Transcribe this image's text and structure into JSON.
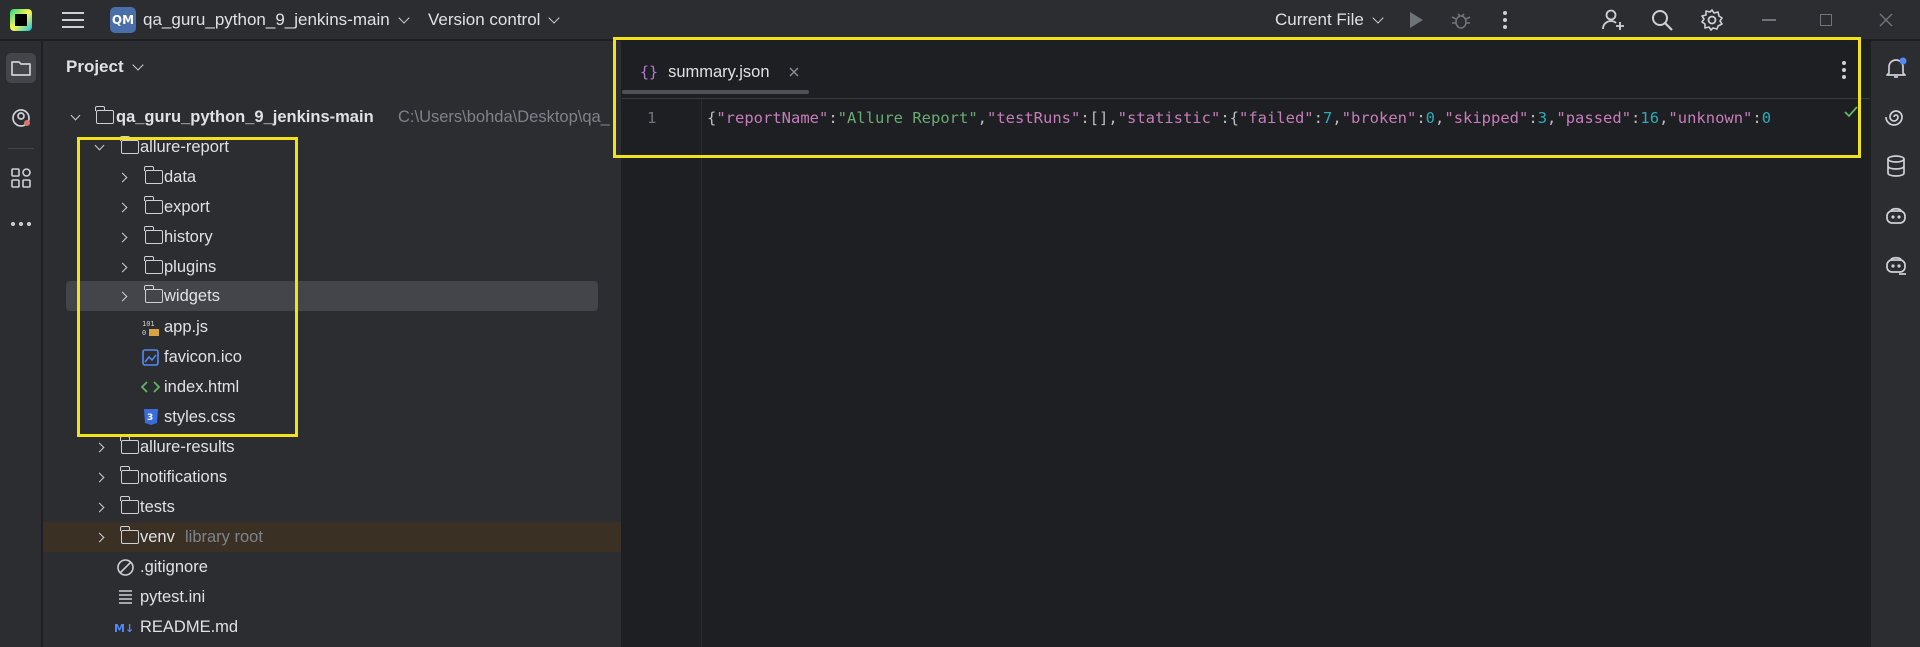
{
  "titlebar": {
    "project_badge": "QM",
    "project_name": "qa_guru_python_9_jenkins-main",
    "version_control": "Version control",
    "run_config": "Current File"
  },
  "project_panel": {
    "title": "Project",
    "root": {
      "name": "qa_guru_python_9_jenkins-main",
      "path": "C:\\Users\\bohda\\Desktop\\qa_"
    },
    "items": [
      {
        "label": "allure-report",
        "kind": "folder",
        "expanded": true
      },
      {
        "label": "data",
        "kind": "folder"
      },
      {
        "label": "export",
        "kind": "folder"
      },
      {
        "label": "history",
        "kind": "folder"
      },
      {
        "label": "plugins",
        "kind": "folder"
      },
      {
        "label": "widgets",
        "kind": "folder"
      },
      {
        "label": "app.js",
        "kind": "js-file"
      },
      {
        "label": "favicon.ico",
        "kind": "image-file"
      },
      {
        "label": "index.html",
        "kind": "html-file"
      },
      {
        "label": "styles.css",
        "kind": "css-file"
      },
      {
        "label": "allure-results",
        "kind": "folder"
      },
      {
        "label": "notifications",
        "kind": "folder"
      },
      {
        "label": "tests",
        "kind": "folder"
      },
      {
        "label": "venv",
        "kind": "folder",
        "note": "library root"
      },
      {
        "label": ".gitignore",
        "kind": "ignore-file"
      },
      {
        "label": "pytest.ini",
        "kind": "ini-file"
      },
      {
        "label": "README.md",
        "kind": "md-file"
      }
    ]
  },
  "editor": {
    "tab_label": "summary.json",
    "line_number": "1",
    "code_tokens": [
      {
        "t": "{",
        "c": "p"
      },
      {
        "t": "\"reportName\"",
        "c": "k"
      },
      {
        "t": ":",
        "c": "p"
      },
      {
        "t": "\"Allure Report\"",
        "c": "s"
      },
      {
        "t": ",",
        "c": "p"
      },
      {
        "t": "\"testRuns\"",
        "c": "k"
      },
      {
        "t": ":[],",
        "c": "p"
      },
      {
        "t": "\"statistic\"",
        "c": "k"
      },
      {
        "t": ":{",
        "c": "p"
      },
      {
        "t": "\"failed\"",
        "c": "k"
      },
      {
        "t": ":",
        "c": "p"
      },
      {
        "t": "7",
        "c": "n"
      },
      {
        "t": ",",
        "c": "p"
      },
      {
        "t": "\"broken\"",
        "c": "k"
      },
      {
        "t": ":",
        "c": "p"
      },
      {
        "t": "0",
        "c": "n"
      },
      {
        "t": ",",
        "c": "p"
      },
      {
        "t": "\"skipped\"",
        "c": "k"
      },
      {
        "t": ":",
        "c": "p"
      },
      {
        "t": "3",
        "c": "n"
      },
      {
        "t": ",",
        "c": "p"
      },
      {
        "t": "\"passed\"",
        "c": "k"
      },
      {
        "t": ":",
        "c": "p"
      },
      {
        "t": "16",
        "c": "n"
      },
      {
        "t": ",",
        "c": "p"
      },
      {
        "t": "\"unknown\"",
        "c": "k"
      },
      {
        "t": ":",
        "c": "p"
      },
      {
        "t": "0",
        "c": "n"
      }
    ]
  },
  "colors": {
    "highlight": "#f2e21a",
    "json_key": "#c77dbb",
    "json_string": "#6aab73",
    "json_number": "#2aacb8"
  }
}
